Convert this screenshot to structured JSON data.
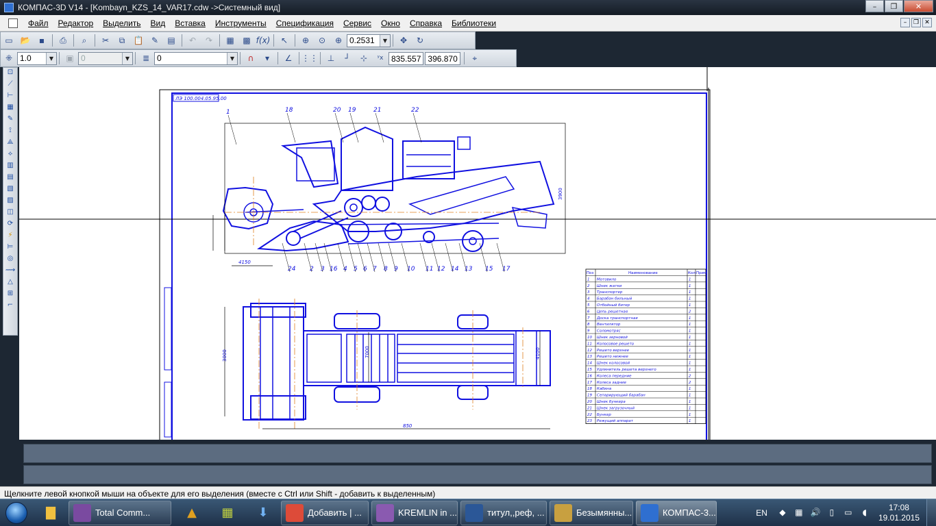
{
  "window": {
    "title": "КОМПАС-3D V14 - [Kombayn_KZS_14_VAR17.cdw ->Системный вид]",
    "minimize": "–",
    "maximize": "❐",
    "close": "✕"
  },
  "menu": {
    "items": [
      "Файл",
      "Редактор",
      "Выделить",
      "Вид",
      "Вставка",
      "Инструменты",
      "Спецификация",
      "Сервис",
      "Окно",
      "Справка",
      "Библиотеки"
    ],
    "mdi_min": "–",
    "mdi_restore": "❐",
    "mdi_close": "✕"
  },
  "toolbar": {
    "zoom_value": "0.2531",
    "step_value": "1.0",
    "angle_value": "0",
    "layer_value": "0",
    "coord_x": "835.557",
    "coord_y": "396.870"
  },
  "drawing": {
    "stamp": "ЛЭ 100.004.05.95.00",
    "dim_length": "850",
    "dim_width": "3000",
    "dim_inner": "7000",
    "dim_right": "4100",
    "dim_height": "3900",
    "dim_a": "4150",
    "callouts": [
      "1",
      "18",
      "20",
      "19",
      "21",
      "22",
      "24",
      "2",
      "3",
      "16",
      "4",
      "5",
      "6",
      "7",
      "8",
      "9",
      "10",
      "11",
      "12",
      "14",
      "13",
      "15",
      "17"
    ]
  },
  "spec_table": {
    "headers": [
      "Поз",
      "Наименование",
      "Кол",
      "Прим"
    ],
    "rows": [
      [
        "1",
        "Мотовило",
        "1"
      ],
      [
        "2",
        "Шнек жатки",
        "1"
      ],
      [
        "3",
        "Транспортер",
        "1"
      ],
      [
        "4",
        "Барабан бильный",
        "1"
      ],
      [
        "5",
        "Отбойный битер",
        "1"
      ],
      [
        "6",
        "Цепь решетная",
        "2"
      ],
      [
        "7",
        "Доска транспортная",
        "1"
      ],
      [
        "8",
        "Вентилятор",
        "1"
      ],
      [
        "9",
        "Соломотряс",
        "1"
      ],
      [
        "10",
        "Шнек зерновой",
        "1"
      ],
      [
        "11",
        "Колосовое решето",
        "1"
      ],
      [
        "12",
        "Решето верхнее",
        "1"
      ],
      [
        "13",
        "Решето нижнее",
        "1"
      ],
      [
        "14",
        "Шнек колосовой",
        "1"
      ],
      [
        "15",
        "Удлинитель решета верхнего",
        "1"
      ],
      [
        "16",
        "Колеса передние",
        "2"
      ],
      [
        "17",
        "Колеса задние",
        "2"
      ],
      [
        "18",
        "Кабина",
        "1"
      ],
      [
        "19",
        "Сепарирующий барабан",
        "1"
      ],
      [
        "20",
        "Шнек бункера",
        "1"
      ],
      [
        "21",
        "Шнек загрузочный",
        "1"
      ],
      [
        "22",
        "Бункер",
        "1"
      ],
      [
        "23",
        "Режущий аппарат",
        "1"
      ]
    ]
  },
  "status": {
    "hint": "Щелкните левой кнопкой мыши на объекте для его выделения (вместе с Ctrl или Shift - добавить к выделенным)"
  },
  "taskbar": {
    "tasks": [
      {
        "label": "Total Comm...",
        "color": "#7a4aa0"
      },
      {
        "label": "Добавить | ...",
        "color": "#dd4b39"
      },
      {
        "label": "KREMLIN in ...",
        "color": "#8a5ab0"
      },
      {
        "label": "титул,,реф, ...",
        "color": "#2b5797"
      },
      {
        "label": "Безымянны...",
        "color": "#c8a040"
      },
      {
        "label": "КОМПАС-3...",
        "color": "#2f6fd0"
      }
    ],
    "lang": "EN",
    "time": "17:08",
    "date": "19.01.2015"
  }
}
